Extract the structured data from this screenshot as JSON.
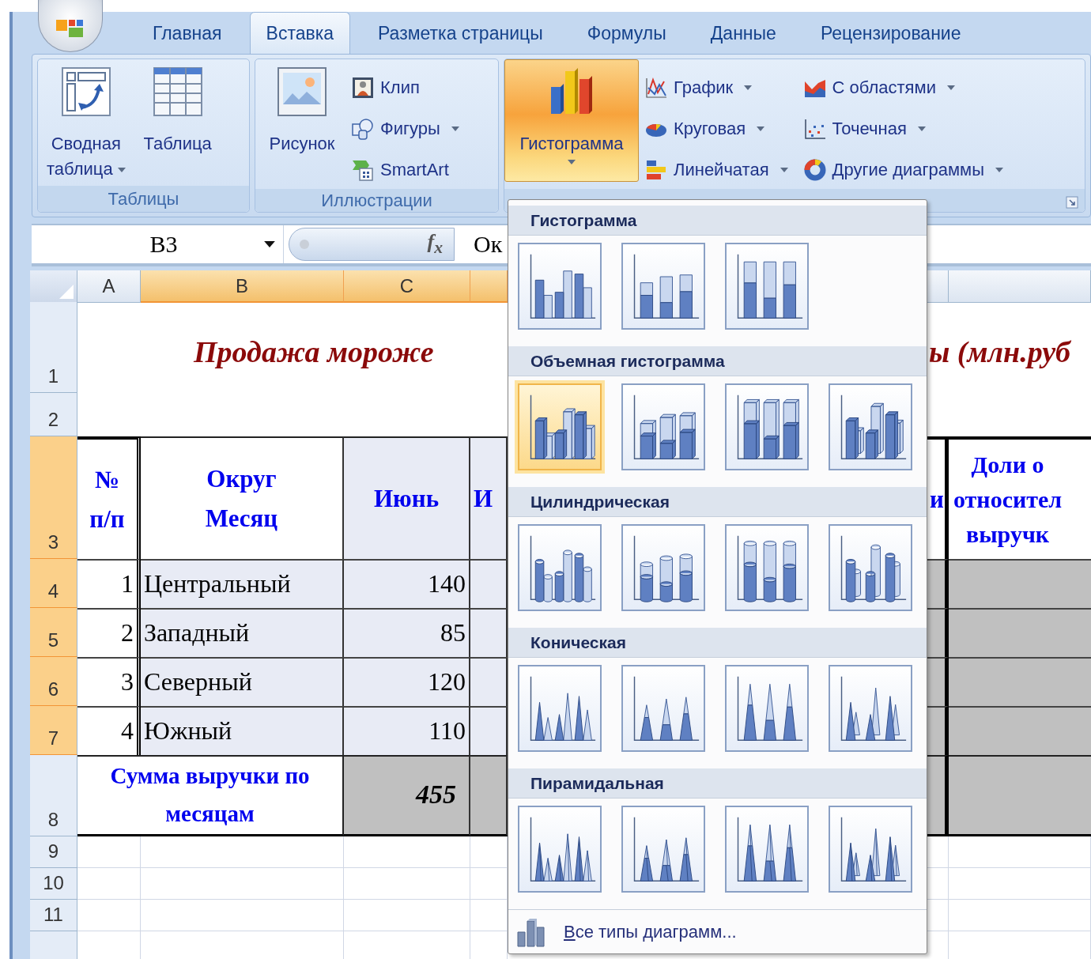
{
  "tabs": [
    {
      "label": "Главная",
      "selected": false
    },
    {
      "label": "Вставка",
      "selected": true
    },
    {
      "label": "Разметка страницы",
      "selected": false
    },
    {
      "label": "Формулы",
      "selected": false
    },
    {
      "label": "Данные",
      "selected": false
    },
    {
      "label": "Рецензирование",
      "selected": false
    }
  ],
  "ribbon": {
    "groups": [
      {
        "label": "Таблицы",
        "items": [
          {
            "kind": "large",
            "label": "Сводная\nтаблица",
            "menu": true,
            "open": false
          },
          {
            "kind": "large",
            "label": "Таблица",
            "open": false
          }
        ]
      },
      {
        "label": "Иллюстрации",
        "items": [
          {
            "kind": "large",
            "label": "Рисунок",
            "open": false
          },
          {
            "kind": "small",
            "label": "Клип"
          },
          {
            "kind": "small",
            "label": "Фигуры",
            "menu": true
          },
          {
            "kind": "small",
            "label": "SmartArt"
          }
        ]
      },
      {
        "launcher": true,
        "items": [
          {
            "kind": "large",
            "label": "Гистограмма",
            "menu": true,
            "open": true
          },
          {
            "kind": "small",
            "label": "График",
            "menu": true
          },
          {
            "kind": "small",
            "label": "Круговая",
            "menu": true
          },
          {
            "kind": "small",
            "label": "Линейчатая",
            "menu": true
          },
          {
            "kind": "small",
            "label": "С областями",
            "menu": true
          },
          {
            "kind": "small",
            "label": "Точечная",
            "menu": true
          },
          {
            "kind": "small",
            "label": "Другие диаграммы",
            "menu": true
          }
        ]
      }
    ]
  },
  "formula_bar": {
    "name_box": "B3",
    "function_label": "f$_{x}$",
    "value": "Ок"
  },
  "sheet": {
    "columns": [
      {
        "label": "A",
        "selected": false
      },
      {
        "label": "B",
        "selected": true
      },
      {
        "label": "C",
        "selected": true
      },
      {
        "selected": true
      },
      {
        "selected": false
      },
      {
        "selected": false
      }
    ],
    "rows": [
      {
        "label": "1",
        "selected": false
      },
      {
        "label": "2",
        "selected": false
      },
      {
        "label": "3",
        "selected": true
      },
      {
        "label": "4",
        "selected": true
      },
      {
        "label": "5",
        "selected": true
      },
      {
        "label": "6",
        "selected": true
      },
      {
        "label": "7",
        "selected": true
      },
      {
        "label": "8",
        "selected": false
      },
      {
        "label": "9",
        "selected": false
      },
      {
        "label": "10",
        "selected": false
      },
      {
        "label": "11",
        "selected": false
      }
    ],
    "title_left": "Продажа мороже",
    "title_right": "ы (млн.руб",
    "header": {
      "number": "№\nп/п",
      "district": "Округ\nМесяц",
      "june": "Июнь",
      "column_d": "И",
      "column_e": "и",
      "column_f": "Доли о\nотносител\nвыручк"
    },
    "records": [
      {
        "number": "1",
        "district": "Центральный",
        "june": "140"
      },
      {
        "number": "2",
        "district": "Западный",
        "june": "85"
      },
      {
        "number": "3",
        "district": "Северный",
        "june": "120"
      },
      {
        "number": "4",
        "district": "Южный",
        "june": "110"
      }
    ],
    "total": {
      "label": "Сумма выручки по\nмесяцам",
      "june": "455"
    }
  },
  "gallery": {
    "sections": [
      {
        "title": "Гистограмма",
        "kind": "column",
        "items": [
          {
            "selected": false
          },
          {
            "selected": false
          },
          {
            "selected": false
          }
        ]
      },
      {
        "title": "Объемная гистограмма",
        "kind": "column3d",
        "items": [
          {
            "selected": true
          },
          {
            "selected": false
          },
          {
            "selected": false
          },
          {
            "selected": false
          }
        ]
      },
      {
        "title": "Цилиндрическая",
        "kind": "cylinder",
        "items": [
          {
            "selected": false
          },
          {
            "selected": false
          },
          {
            "selected": false
          },
          {
            "selected": false
          }
        ]
      },
      {
        "title": "Коническая",
        "kind": "cone",
        "items": [
          {
            "selected": false
          },
          {
            "selected": false
          },
          {
            "selected": false
          },
          {
            "selected": false
          }
        ]
      },
      {
        "title": "Пирамидальная",
        "kind": "pyramid",
        "items": [
          {
            "selected": false
          },
          {
            "selected": false
          },
          {
            "selected": false
          },
          {
            "selected": false
          }
        ]
      }
    ],
    "footer": "Все типы диаграмм..."
  }
}
